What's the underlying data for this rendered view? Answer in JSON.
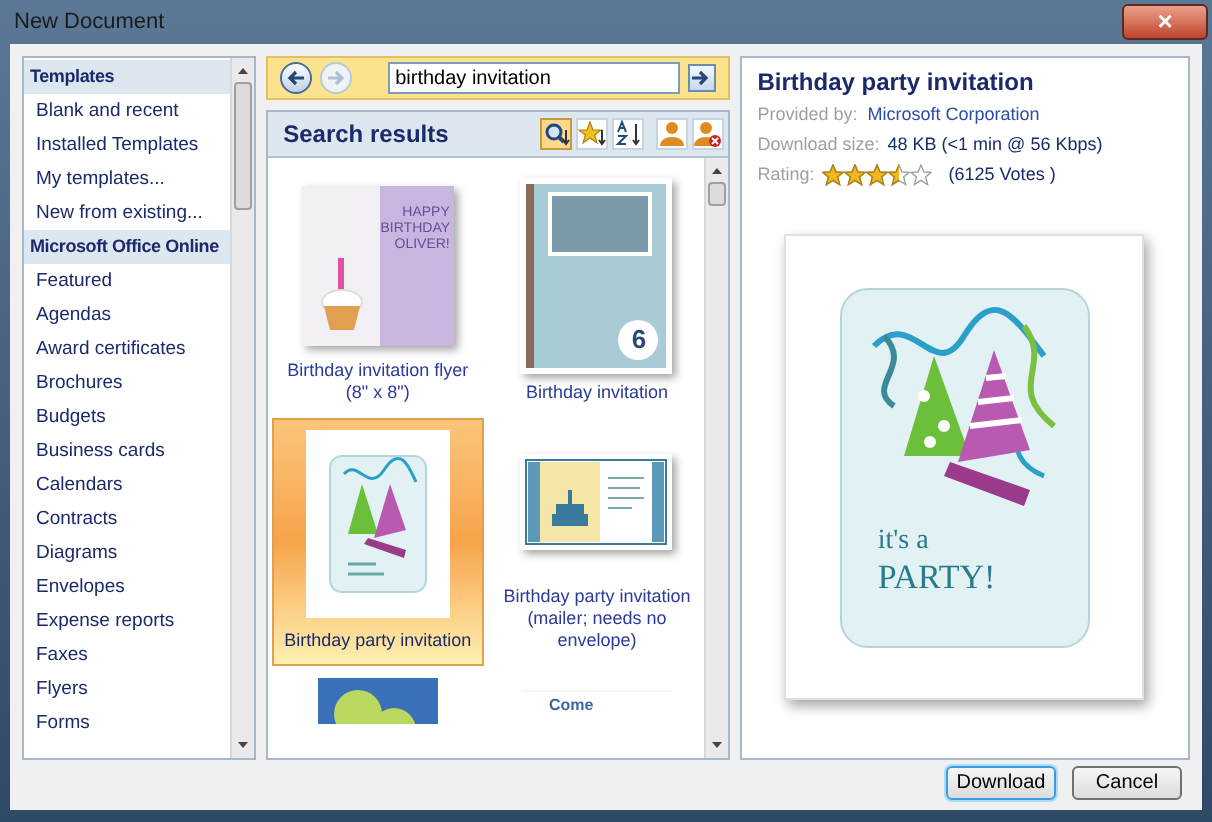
{
  "window": {
    "title": "New Document",
    "close": "×"
  },
  "sidebar": {
    "items": [
      {
        "label": "Templates",
        "kind": "header"
      },
      {
        "label": "Blank and recent",
        "kind": "item"
      },
      {
        "label": "Installed Templates",
        "kind": "item"
      },
      {
        "label": "My templates...",
        "kind": "item"
      },
      {
        "label": "New from existing...",
        "kind": "item"
      },
      {
        "label": "Microsoft Office Online",
        "kind": "header"
      },
      {
        "label": "Featured",
        "kind": "item"
      },
      {
        "label": "Agendas",
        "kind": "item"
      },
      {
        "label": "Award certificates",
        "kind": "item"
      },
      {
        "label": "Brochures",
        "kind": "item"
      },
      {
        "label": "Budgets",
        "kind": "item"
      },
      {
        "label": "Business cards",
        "kind": "item"
      },
      {
        "label": "Calendars",
        "kind": "item"
      },
      {
        "label": "Contracts",
        "kind": "item"
      },
      {
        "label": "Diagrams",
        "kind": "item"
      },
      {
        "label": "Envelopes",
        "kind": "item"
      },
      {
        "label": "Expense reports",
        "kind": "item"
      },
      {
        "label": "Faxes",
        "kind": "item"
      },
      {
        "label": "Flyers",
        "kind": "item"
      },
      {
        "label": "Forms",
        "kind": "item"
      }
    ]
  },
  "toolbar": {
    "back_disabled": false,
    "forward_disabled": true,
    "search_value": "birthday invitation"
  },
  "results": {
    "title": "Search results",
    "view_buttons": [
      {
        "kind": "search",
        "selected": true
      },
      {
        "kind": "rating-sort",
        "selected": false
      },
      {
        "kind": "az-sort",
        "selected": false
      },
      {
        "kind": "user",
        "selected": false
      },
      {
        "kind": "user-remove",
        "selected": false
      }
    ],
    "items": [
      {
        "kind": "flyer",
        "label": "Birthday invitation flyer (8\" x 8\")",
        "thumb_text": "HAPPY BIRTHDAY OLIVER!",
        "selected": false
      },
      {
        "kind": "photo",
        "label": "Birthday invitation",
        "thumb_text": "6",
        "selected": false
      },
      {
        "kind": "party",
        "label": "Birthday party invitation",
        "selected": true
      },
      {
        "kind": "mailer",
        "label": "Birthday party invitation (mailer; needs no envelope)",
        "selected": false
      },
      {
        "kind": "balloons",
        "selected": false
      },
      {
        "kind": "come",
        "thumb_text": "Come",
        "selected": false
      }
    ]
  },
  "detail": {
    "title": "Birthday party invitation",
    "provided_by_label": "Provided by:",
    "provided_by": "Microsoft Corporation",
    "size_label": "Download size:",
    "size": "48 KB (<1 min @ 56 Kbps)",
    "rating_label": "Rating:",
    "stars": 3.5,
    "votes": "(6125 Votes )",
    "preview_text_1": "it's a",
    "preview_text_2": "PARTY!"
  },
  "buttons": [
    {
      "label": "Download",
      "default": true
    },
    {
      "label": "Cancel",
      "default": false
    }
  ]
}
